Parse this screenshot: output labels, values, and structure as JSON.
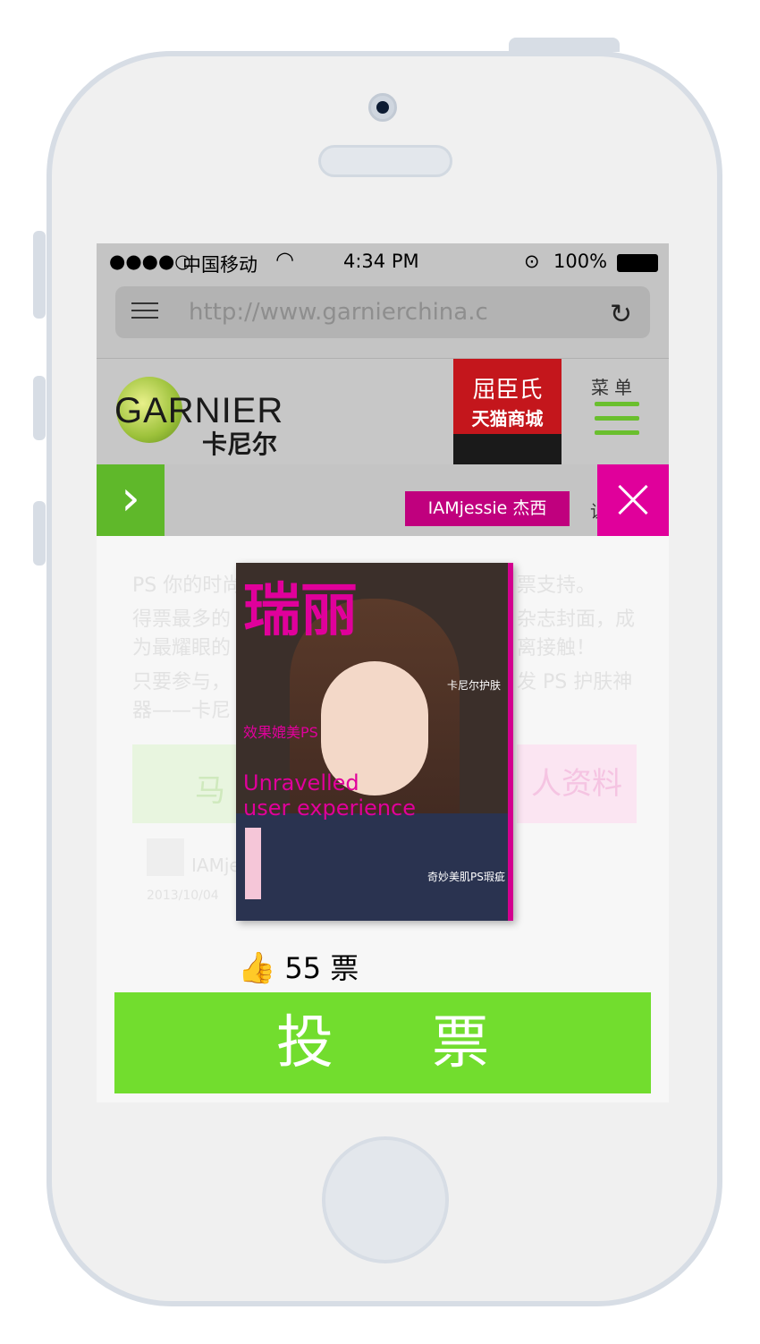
{
  "status_bar": {
    "signal": "●●●●○",
    "carrier": "中国移动",
    "wifi": "◠",
    "time": "4:34 PM",
    "battery": "100%"
  },
  "browser": {
    "url": "http://www.garnierchina.c",
    "reload_icon": "↻"
  },
  "header": {
    "logo_text": "GARNIER",
    "logo_cn": "卡尼尔",
    "tmall_line1": "屈臣氏",
    "tmall_line2": "天猫商城",
    "menu_label": "菜单"
  },
  "sub_bar": {
    "arrow": "›",
    "user_tag": "IAMjessie 杰西",
    "truncated_text": "让"
  },
  "background_text": {
    "line1": "PS 你的时尚",
    "line1_end": "票支持。",
    "line2": "得票最多的",
    "line2_end": "杂志封面，成",
    "line3": "为最耀眼的",
    "line3_end": "离接触！",
    "line4": "只要参与，",
    "line4_end": "发 PS 护肤神",
    "line5": "器——卡尼",
    "btn_left": "马",
    "btn_right": "人资料",
    "user_name": "IAMje",
    "date": "2013/10/04"
  },
  "cover": {
    "title": "瑞丽",
    "line_a": "效果媲美PS",
    "line_b": "Unravelled",
    "line_c": "user experience",
    "side_text": "卡尼尔护肤",
    "bottom_text": "奇妙美肌PS瑕疵"
  },
  "vote": {
    "count": "55",
    "unit": "票",
    "button_label": "投票"
  }
}
